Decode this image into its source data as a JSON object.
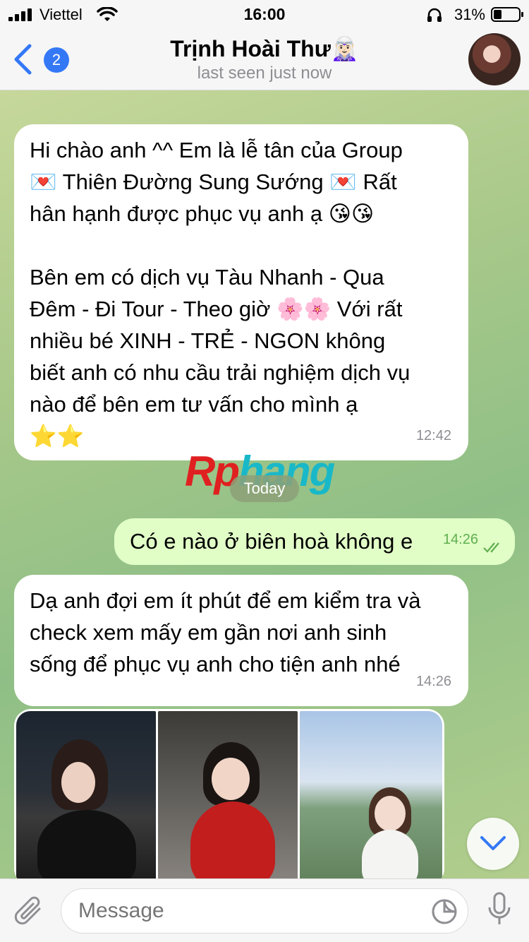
{
  "status": {
    "carrier": "Viettel",
    "time": "16:00",
    "battery_pct": "31%"
  },
  "header": {
    "back_badge": "2",
    "contact_name": "Trịnh Hoài Thư",
    "contact_emoji": "🧝🏻‍♀️",
    "last_seen": "last seen just now"
  },
  "messages": [
    {
      "direction": "in",
      "text": "Hi chào anh ^^ Em là lễ tân của Group\n💌 Thiên Đường Sung Sướng 💌 Rất\nhân hạnh được phục vụ anh ạ 😘😘\n\nBên em có dịch vụ Tàu Nhanh - Qua\nĐêm - Đi Tour - Theo giờ 🌸🌸 Với rất\nnhiều bé XINH - TRẺ - NGON không\nbiết anh có nhu cầu trải nghiệm dịch vụ\nnào để bên em tư vấn cho mình ạ\n⭐⭐",
      "time": "12:42"
    },
    {
      "direction": "out",
      "text": "Có e nào ở biên hoà không e",
      "time": "14:26",
      "read": true
    },
    {
      "direction": "in",
      "text": "Dạ anh đợi em ít phút để em kiểm tra và\ncheck xem mấy em gần nơi anh sinh\nsống để phục vụ anh cho tiện anh nhé",
      "time": "14:26"
    }
  ],
  "date_separator": "Today",
  "watermark": {
    "part1": "Rp",
    "part2": "hang"
  },
  "photos": [
    "photo-1",
    "photo-2",
    "photo-3"
  ],
  "input": {
    "placeholder": "Message"
  },
  "colors": {
    "accent": "#3478f6",
    "outgoing_bubble": "#e1fec7",
    "incoming_bubble": "#ffffff",
    "read_check": "#5fae4e"
  }
}
